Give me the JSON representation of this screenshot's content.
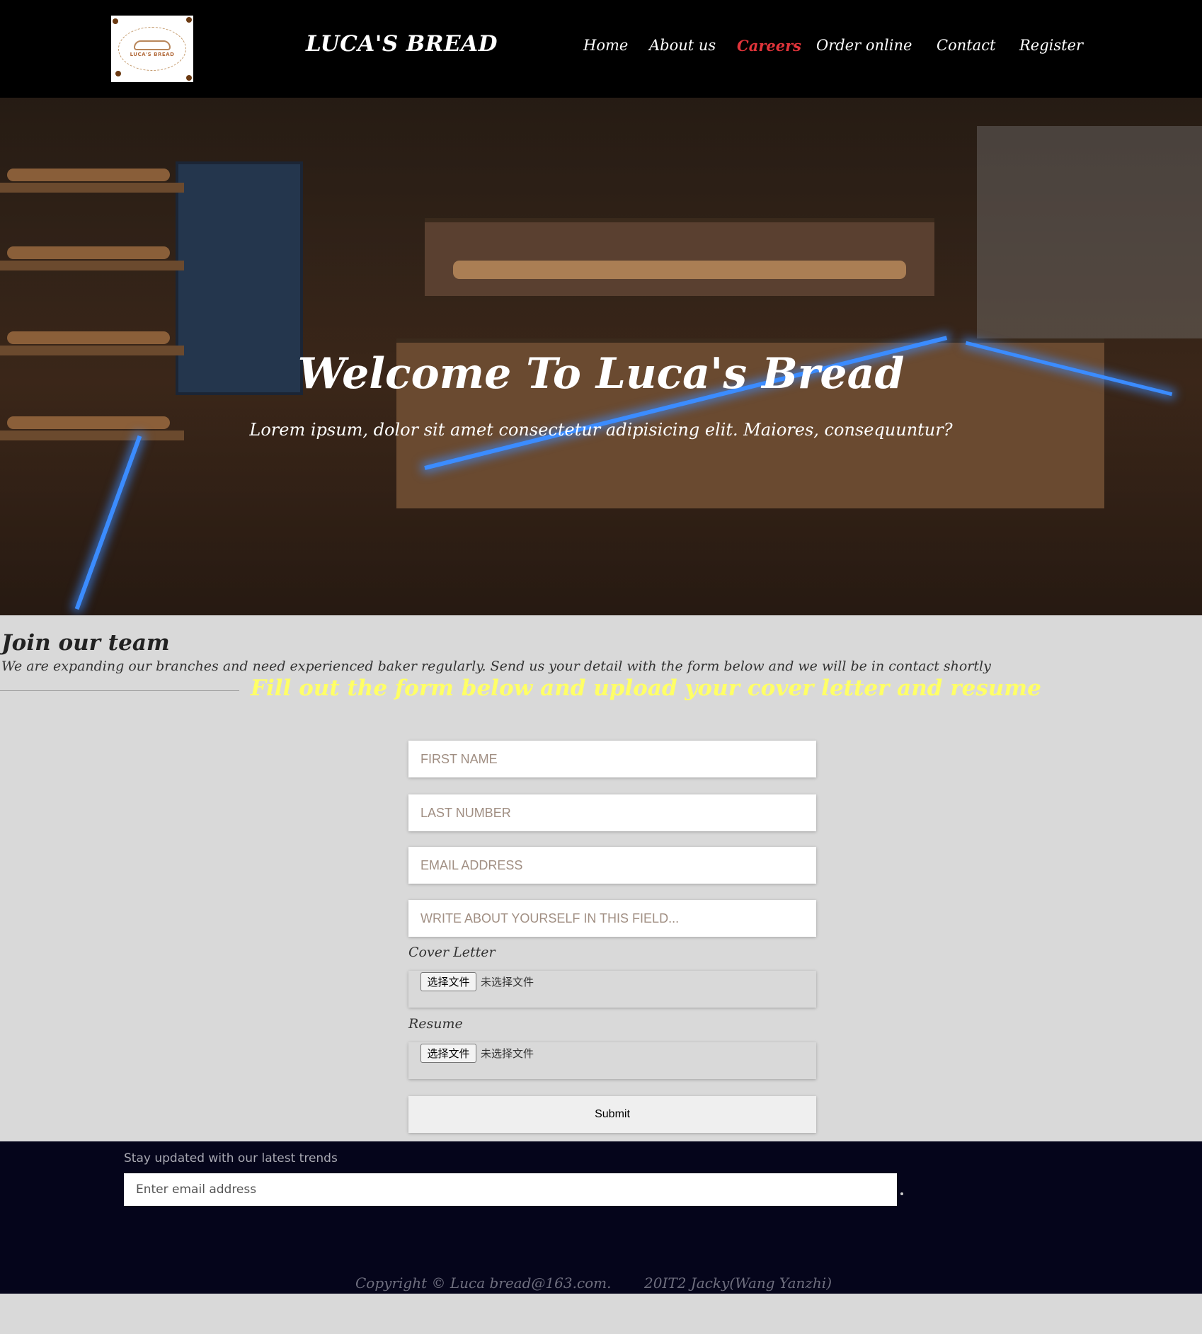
{
  "header": {
    "logo_text": "LUCA'S BREAD",
    "brand": "LUCA'S BREAD",
    "nav": [
      {
        "label": "Home",
        "active": false
      },
      {
        "label": "About us",
        "active": false
      },
      {
        "label": "Careers",
        "active": true
      },
      {
        "label": "Order online",
        "active": false
      },
      {
        "label": "Contact",
        "active": false
      },
      {
        "label": "Register",
        "active": false
      }
    ]
  },
  "hero": {
    "title": "Welcome To Luca's Bread",
    "subtitle": "Lorem ipsum, dolor sit amet consectetur adipisicing elit. Maiores, consequuntur?"
  },
  "join": {
    "title": "Join our team",
    "text": "We are expanding our branches and need experienced baker regularly. Send us your detail with the form below and we will be in contact shortly",
    "form_heading": "Fill out the form below and upload your cover letter and resume"
  },
  "form": {
    "first_name_placeholder": "FIRST NAME",
    "last_name_placeholder": "LAST NUMBER",
    "email_placeholder": "EMAIL ADDRESS",
    "about_placeholder": "WRITE ABOUT YOURSELF IN THIS FIELD...",
    "cover_letter_label": "Cover Letter",
    "resume_label": "Resume",
    "file_button": "选择文件",
    "file_status": "未选择文件",
    "submit_label": "Submit"
  },
  "footer": {
    "note": "Stay updated with our latest trends",
    "email_placeholder": "Enter email address",
    "copyright": "Copyright © Luca bread@163.com.",
    "author": "20IT2 Jacky(Wang Yanzhi)"
  },
  "colors": {
    "header_bg": "#000000",
    "active_nav": "#e0343a",
    "form_heading": "#ffff66",
    "page_bg": "#d9d9d9",
    "footer_bg": "#05051b"
  }
}
